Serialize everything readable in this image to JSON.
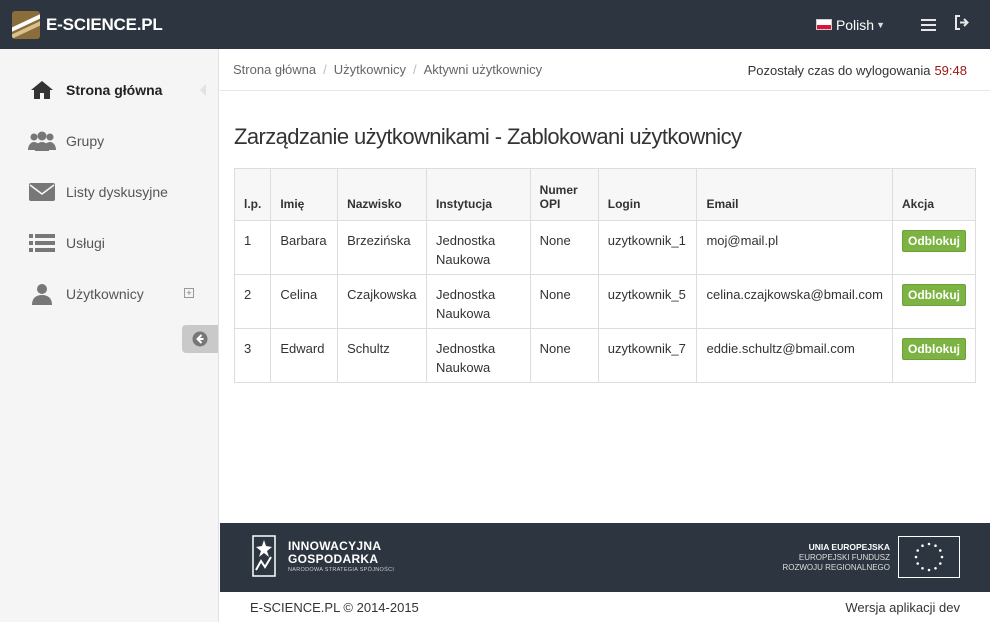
{
  "app": {
    "logo_text": "E-SCIENCE.PL"
  },
  "topbar": {
    "language": "Polish"
  },
  "sidebar": {
    "items": [
      {
        "label": "Strona główna",
        "icon": "home-icon"
      },
      {
        "label": "Grupy",
        "icon": "users-group-icon"
      },
      {
        "label": "Listy dyskusyjne",
        "icon": "envelope-icon"
      },
      {
        "label": "Usługi",
        "icon": "list-icon"
      },
      {
        "label": "Użytkownicy",
        "icon": "user-icon"
      }
    ]
  },
  "breadcrumb": {
    "items": [
      "Strona główna",
      "Użytkownicy",
      "Aktywni użytkownicy"
    ],
    "separator": "/"
  },
  "session": {
    "label": "Pozostały czas do wylogowania",
    "time": "59:48"
  },
  "page": {
    "title": "Zarządzanie użytkownikami - Zablokowani użytkownicy"
  },
  "table": {
    "headers": {
      "lp": "l.p.",
      "first": "Imię",
      "last": "Nazwisko",
      "inst": "Instytucja",
      "opi1": "Numer",
      "opi2": "OPI",
      "login": "Login",
      "email": "Email",
      "action": "Akcja"
    },
    "rows": [
      {
        "lp": "1",
        "first": "Barbara",
        "last": "Brzezińska",
        "inst1": "Jednostka",
        "inst2": "Naukowa",
        "opi": "None",
        "login": "uzytkownik_1",
        "email": "moj@mail.pl",
        "action": "Odblokuj"
      },
      {
        "lp": "2",
        "first": "Celina",
        "last": "Czajkowska",
        "inst1": "Jednostka",
        "inst2": "Naukowa",
        "opi": "None",
        "login": "uzytkownik_5",
        "email": "celina.czajkowska@bmail.com",
        "action": "Odblokuj"
      },
      {
        "lp": "3",
        "first": "Edward",
        "last": "Schultz",
        "inst1": "Jednostka",
        "inst2": "Naukowa",
        "opi": "None",
        "login": "uzytkownik_7",
        "email": "eddie.schultz@bmail.com",
        "action": "Odblokuj"
      }
    ]
  },
  "footer": {
    "ig_line1": "INNOWACYJNA",
    "ig_line2": "GOSPODARKA",
    "ig_line3": "NARODOWA STRATEGIA SPÓJNOŚCI",
    "eu_line1": "UNIA EUROPEJSKA",
    "eu_line2": "EUROPEJSKI FUNDUSZ",
    "eu_line3": "ROZWOJU REGIONALNEGO",
    "copyright": "E-SCIENCE.PL © 2014-2015",
    "version": "Wersja aplikacji dev"
  },
  "colors": {
    "topbar": "#2d3640",
    "accent_green": "#7cb342",
    "timer_red": "#a01818",
    "brand_gold": "#8a6d3b"
  }
}
